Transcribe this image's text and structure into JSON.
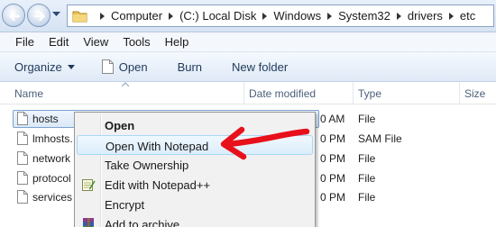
{
  "address_bar": {
    "breadcrumbs": [
      "Computer",
      "(C:) Local Disk",
      "Windows",
      "System32",
      "drivers",
      "etc"
    ]
  },
  "menu_bar": {
    "items": [
      "File",
      "Edit",
      "View",
      "Tools",
      "Help"
    ]
  },
  "command_bar": {
    "organize": "Organize",
    "open": "Open",
    "burn": "Burn",
    "new_folder": "New folder"
  },
  "columns": {
    "name": "Name",
    "date_modified": "Date modified",
    "type": "Type",
    "size": "Size"
  },
  "files": [
    {
      "name": "hosts",
      "date": "0 AM",
      "type": "File"
    },
    {
      "name": "lmhosts.",
      "date": "0 PM",
      "type": "SAM File"
    },
    {
      "name": "network",
      "date": "0 PM",
      "type": "File"
    },
    {
      "name": "protocol",
      "date": "0 PM",
      "type": "File"
    },
    {
      "name": "services",
      "date": "0 PM",
      "type": "File"
    }
  ],
  "context_menu": {
    "items": [
      {
        "label": "Open",
        "bold": true,
        "icon": ""
      },
      {
        "label": "Open With Notepad",
        "bold": false,
        "icon": ""
      },
      {
        "label": "Take Ownership",
        "bold": false,
        "icon": ""
      },
      {
        "label": "Edit with Notepad++",
        "bold": false,
        "icon": "notepad-plus-plus-icon"
      },
      {
        "label": "Encrypt",
        "bold": false,
        "icon": ""
      },
      {
        "label": "Add to archive...",
        "bold": false,
        "icon": "winrar-archive-icon"
      }
    ],
    "highlighted_item": "Open With Notepad"
  },
  "colors": {
    "accent_border": "#7da2ce",
    "annotation_arrow": "#e8101a",
    "command_text": "#1e395b"
  },
  "icons": [
    "back-arrow-icon",
    "forward-arrow-icon",
    "folder-icon",
    "document-icon",
    "red-annotation-arrow"
  ]
}
